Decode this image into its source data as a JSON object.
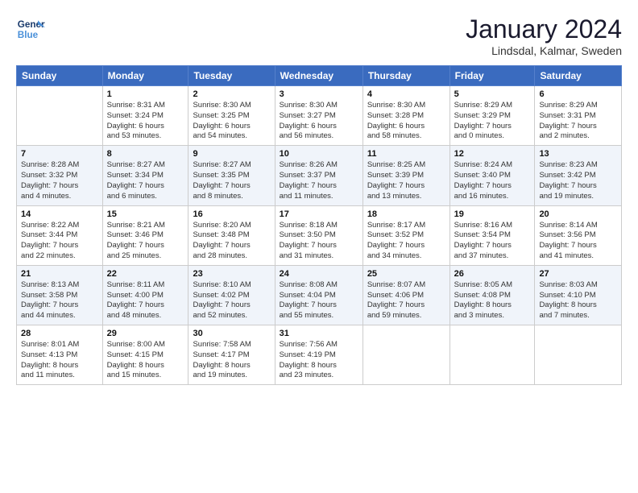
{
  "logo": {
    "line1": "General",
    "line2": "Blue"
  },
  "title": "January 2024",
  "subtitle": "Lindsdal, Kalmar, Sweden",
  "headers": [
    "Sunday",
    "Monday",
    "Tuesday",
    "Wednesday",
    "Thursday",
    "Friday",
    "Saturday"
  ],
  "weeks": [
    [
      {
        "num": "",
        "info": ""
      },
      {
        "num": "1",
        "info": "Sunrise: 8:31 AM\nSunset: 3:24 PM\nDaylight: 6 hours\nand 53 minutes."
      },
      {
        "num": "2",
        "info": "Sunrise: 8:30 AM\nSunset: 3:25 PM\nDaylight: 6 hours\nand 54 minutes."
      },
      {
        "num": "3",
        "info": "Sunrise: 8:30 AM\nSunset: 3:27 PM\nDaylight: 6 hours\nand 56 minutes."
      },
      {
        "num": "4",
        "info": "Sunrise: 8:30 AM\nSunset: 3:28 PM\nDaylight: 6 hours\nand 58 minutes."
      },
      {
        "num": "5",
        "info": "Sunrise: 8:29 AM\nSunset: 3:29 PM\nDaylight: 7 hours\nand 0 minutes."
      },
      {
        "num": "6",
        "info": "Sunrise: 8:29 AM\nSunset: 3:31 PM\nDaylight: 7 hours\nand 2 minutes."
      }
    ],
    [
      {
        "num": "7",
        "info": "Sunrise: 8:28 AM\nSunset: 3:32 PM\nDaylight: 7 hours\nand 4 minutes."
      },
      {
        "num": "8",
        "info": "Sunrise: 8:27 AM\nSunset: 3:34 PM\nDaylight: 7 hours\nand 6 minutes."
      },
      {
        "num": "9",
        "info": "Sunrise: 8:27 AM\nSunset: 3:35 PM\nDaylight: 7 hours\nand 8 minutes."
      },
      {
        "num": "10",
        "info": "Sunrise: 8:26 AM\nSunset: 3:37 PM\nDaylight: 7 hours\nand 11 minutes."
      },
      {
        "num": "11",
        "info": "Sunrise: 8:25 AM\nSunset: 3:39 PM\nDaylight: 7 hours\nand 13 minutes."
      },
      {
        "num": "12",
        "info": "Sunrise: 8:24 AM\nSunset: 3:40 PM\nDaylight: 7 hours\nand 16 minutes."
      },
      {
        "num": "13",
        "info": "Sunrise: 8:23 AM\nSunset: 3:42 PM\nDaylight: 7 hours\nand 19 minutes."
      }
    ],
    [
      {
        "num": "14",
        "info": "Sunrise: 8:22 AM\nSunset: 3:44 PM\nDaylight: 7 hours\nand 22 minutes."
      },
      {
        "num": "15",
        "info": "Sunrise: 8:21 AM\nSunset: 3:46 PM\nDaylight: 7 hours\nand 25 minutes."
      },
      {
        "num": "16",
        "info": "Sunrise: 8:20 AM\nSunset: 3:48 PM\nDaylight: 7 hours\nand 28 minutes."
      },
      {
        "num": "17",
        "info": "Sunrise: 8:18 AM\nSunset: 3:50 PM\nDaylight: 7 hours\nand 31 minutes."
      },
      {
        "num": "18",
        "info": "Sunrise: 8:17 AM\nSunset: 3:52 PM\nDaylight: 7 hours\nand 34 minutes."
      },
      {
        "num": "19",
        "info": "Sunrise: 8:16 AM\nSunset: 3:54 PM\nDaylight: 7 hours\nand 37 minutes."
      },
      {
        "num": "20",
        "info": "Sunrise: 8:14 AM\nSunset: 3:56 PM\nDaylight: 7 hours\nand 41 minutes."
      }
    ],
    [
      {
        "num": "21",
        "info": "Sunrise: 8:13 AM\nSunset: 3:58 PM\nDaylight: 7 hours\nand 44 minutes."
      },
      {
        "num": "22",
        "info": "Sunrise: 8:11 AM\nSunset: 4:00 PM\nDaylight: 7 hours\nand 48 minutes."
      },
      {
        "num": "23",
        "info": "Sunrise: 8:10 AM\nSunset: 4:02 PM\nDaylight: 7 hours\nand 52 minutes."
      },
      {
        "num": "24",
        "info": "Sunrise: 8:08 AM\nSunset: 4:04 PM\nDaylight: 7 hours\nand 55 minutes."
      },
      {
        "num": "25",
        "info": "Sunrise: 8:07 AM\nSunset: 4:06 PM\nDaylight: 7 hours\nand 59 minutes."
      },
      {
        "num": "26",
        "info": "Sunrise: 8:05 AM\nSunset: 4:08 PM\nDaylight: 8 hours\nand 3 minutes."
      },
      {
        "num": "27",
        "info": "Sunrise: 8:03 AM\nSunset: 4:10 PM\nDaylight: 8 hours\nand 7 minutes."
      }
    ],
    [
      {
        "num": "28",
        "info": "Sunrise: 8:01 AM\nSunset: 4:13 PM\nDaylight: 8 hours\nand 11 minutes."
      },
      {
        "num": "29",
        "info": "Sunrise: 8:00 AM\nSunset: 4:15 PM\nDaylight: 8 hours\nand 15 minutes."
      },
      {
        "num": "30",
        "info": "Sunrise: 7:58 AM\nSunset: 4:17 PM\nDaylight: 8 hours\nand 19 minutes."
      },
      {
        "num": "31",
        "info": "Sunrise: 7:56 AM\nSunset: 4:19 PM\nDaylight: 8 hours\nand 23 minutes."
      },
      {
        "num": "",
        "info": ""
      },
      {
        "num": "",
        "info": ""
      },
      {
        "num": "",
        "info": ""
      }
    ]
  ]
}
